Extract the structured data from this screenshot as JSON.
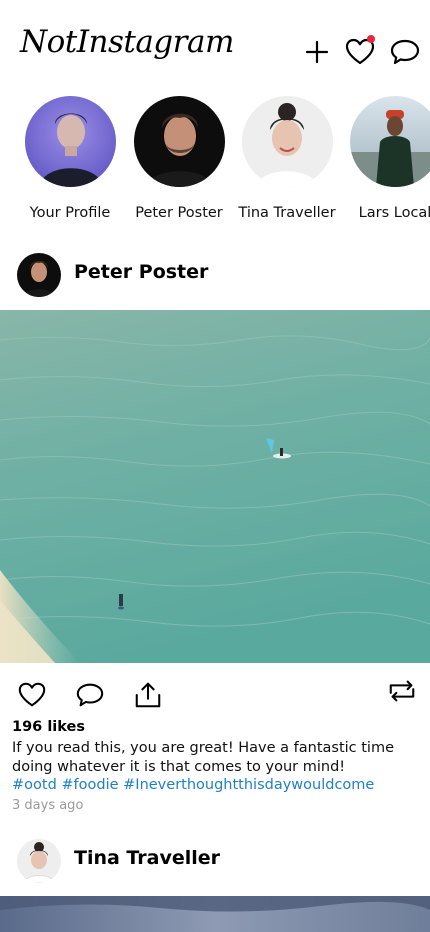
{
  "app": {
    "title": "NotInstagram"
  },
  "header": {
    "icons": [
      "plus-icon",
      "heart-icon",
      "chat-bubble-icon"
    ],
    "notification_dot_color": "#e8273f"
  },
  "stories": [
    {
      "label": "Your Profile"
    },
    {
      "label": "Peter Poster"
    },
    {
      "label": "Tina Traveller"
    },
    {
      "label": "Lars Local"
    }
  ],
  "posts": [
    {
      "author": "Peter Poster",
      "likes": "196 likes",
      "caption": "If you read this, you are great! Have a fantastic time doing whatever it is that comes to your mind!",
      "hashtags": "#ootd #foodie #Ineverthoughtthisdaywouldcome",
      "time_ago": "3 days ago",
      "actions": [
        "heart-icon",
        "comment-icon",
        "share-icon",
        "repost-icon"
      ]
    },
    {
      "author": "Tina Traveller"
    }
  ],
  "colors": {
    "hashtag": "#1f7fc8",
    "time": "#9a9a9a"
  }
}
